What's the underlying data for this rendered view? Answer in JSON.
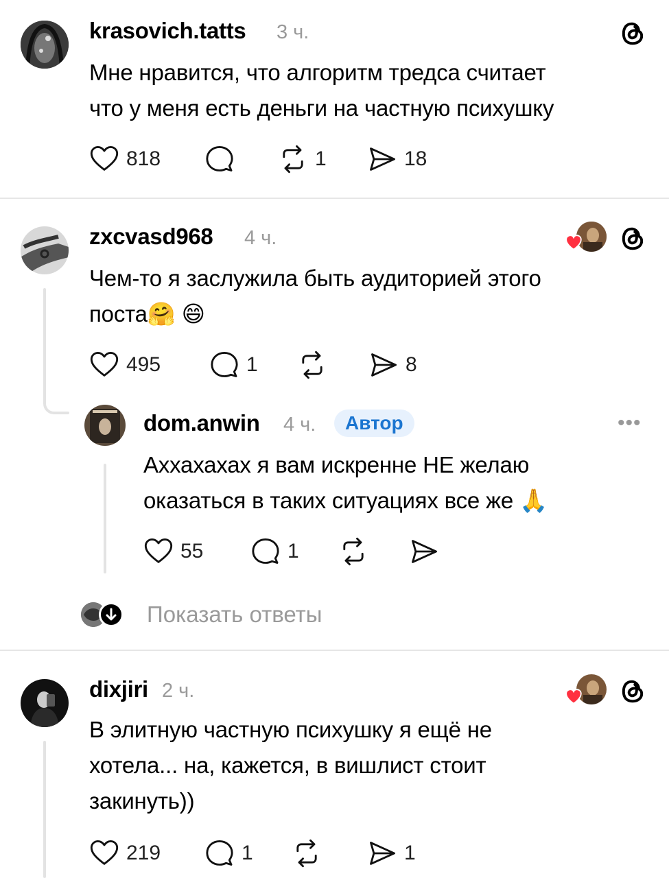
{
  "comments": [
    {
      "username": "krasovich.tatts",
      "time": "3 ч.",
      "text_lines": [
        "Мне нравится, что алгоритм тредса считает",
        "что у меня есть деньги на частную психушку"
      ],
      "likes": "818",
      "replies": "",
      "reposts": "1",
      "shares": "18"
    },
    {
      "username": "zxcvasd968",
      "time": "4 ч.",
      "text_lines": [
        "Чем-то я заслужила быть аудиторией этого",
        "поста"
      ],
      "emoji": "🤗 😄",
      "likes": "495",
      "replies": "1",
      "reposts": "",
      "shares": "8"
    },
    {
      "username": "dom.anwin",
      "time": "4 ч.",
      "badge": "Автор",
      "more": "•••",
      "text_lines": [
        "Аххахахах я вам искренне НЕ желаю",
        "оказаться в таких ситуациях все же"
      ],
      "emoji": "🙏",
      "likes": "55",
      "replies": "1",
      "reposts": "",
      "shares": ""
    },
    {
      "username": "dixjiri",
      "time": "2 ч.",
      "text_lines": [
        "В элитную частную психушку я ещё не",
        "хотела... на, кажется, в вишлист стоит",
        "закинуть))"
      ],
      "likes": "219",
      "replies": "1",
      "reposts": "",
      "shares": "1"
    }
  ],
  "show_replies_label": "Показать ответы",
  "colors": {
    "like_red": "#ff3040",
    "badge_blue": "#1b75d0",
    "muted": "#9a9a9a"
  }
}
